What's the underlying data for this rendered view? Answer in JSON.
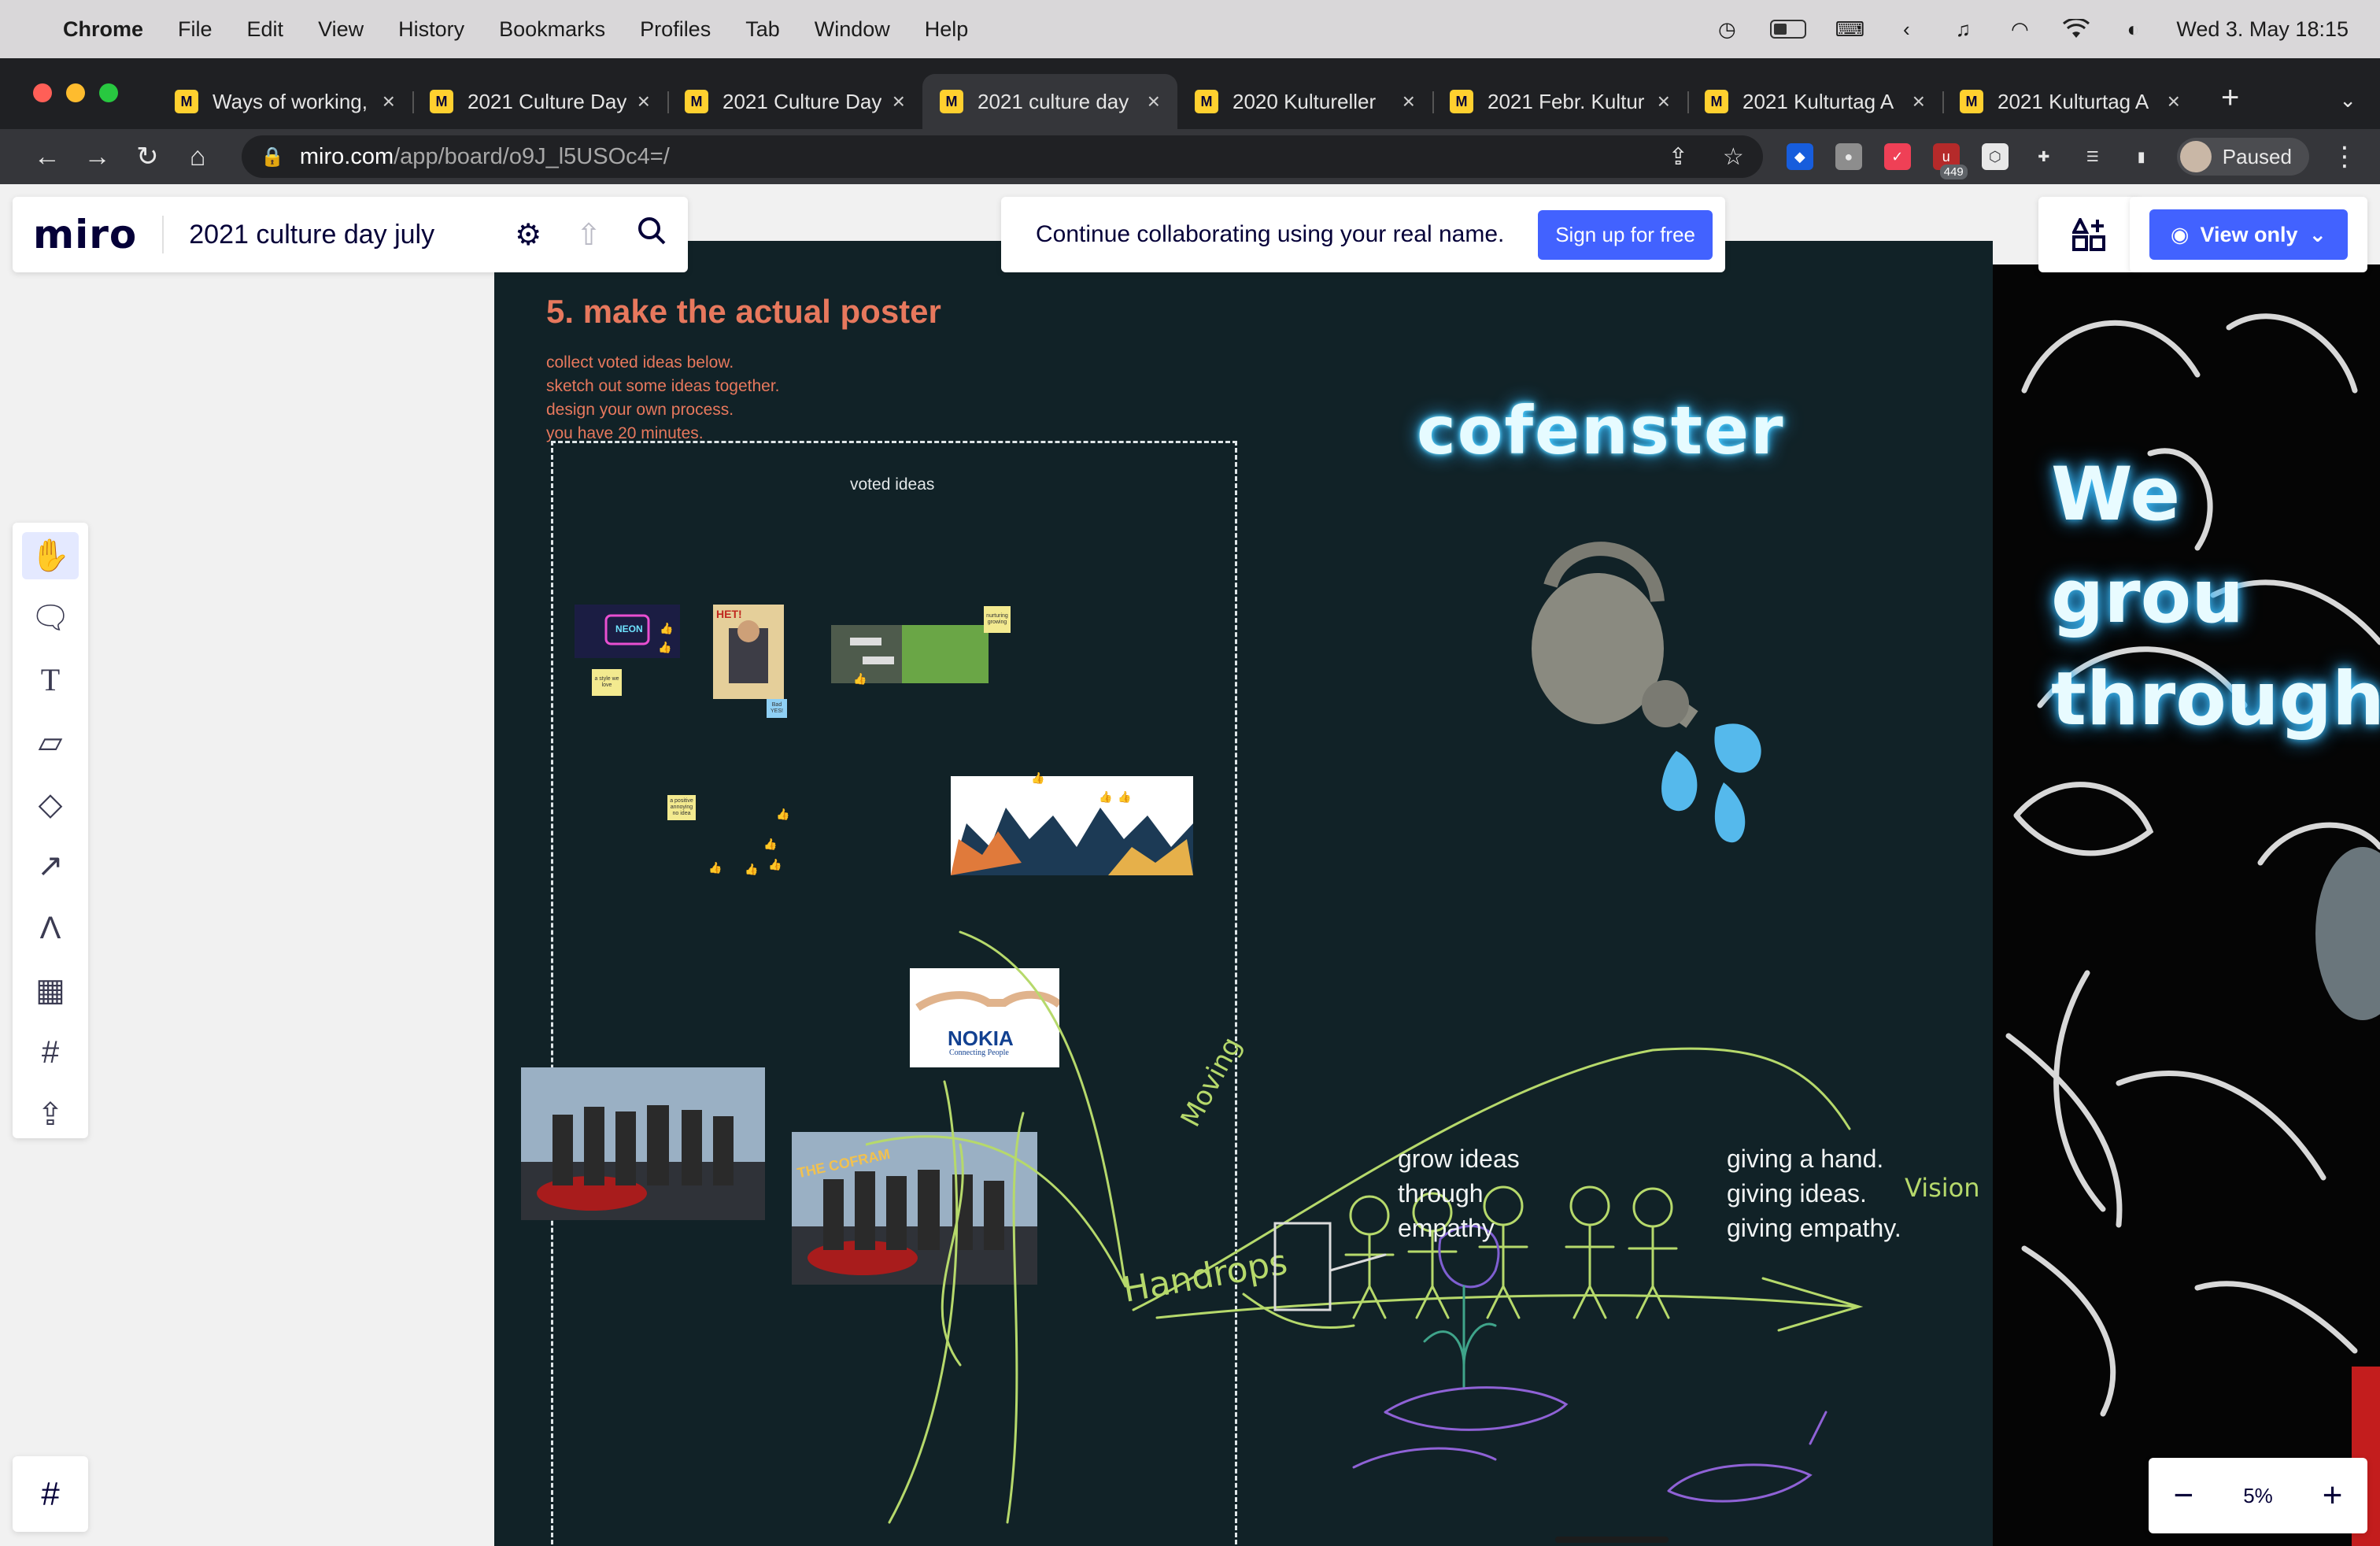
{
  "menubar": {
    "app": "Chrome",
    "items": [
      "File",
      "Edit",
      "View",
      "History",
      "Bookmarks",
      "Profiles",
      "Tab",
      "Window",
      "Help"
    ],
    "clock": "Wed 3. May  18:15"
  },
  "tabs": [
    {
      "title": "Ways of working,",
      "active": false
    },
    {
      "title": "2021 Culture Day",
      "active": false
    },
    {
      "title": "2021 Culture Day",
      "active": false
    },
    {
      "title": "2021 culture day",
      "active": true
    },
    {
      "title": "2020 Kultureller",
      "active": false
    },
    {
      "title": "2021 Febr. Kultur",
      "active": false
    },
    {
      "title": "2021 Kulturtag A",
      "active": false
    },
    {
      "title": "2021 Kulturtag A",
      "active": false
    }
  ],
  "tab_favicon": "M",
  "toolbar": {
    "url_host": "miro.com",
    "url_path": "/app/board/o9J_l5USOc4=/",
    "extension_badge": "449",
    "profile_label": "Paused"
  },
  "miro": {
    "logo": "miro",
    "board_name": "2021 culture day july",
    "banner_text": "Continue collaborating using your real name.",
    "signup_label": "Sign up for free",
    "view_only_label": "View only",
    "zoom_level": "5%",
    "zoom_minus": "−",
    "zoom_plus": "+"
  },
  "board": {
    "section_title": "5. make the actual poster",
    "instructions": [
      "collect voted ideas below.",
      "sketch out some ideas together.",
      "design your own process.",
      "you have 20 minutes."
    ],
    "voted_label": "voted ideas",
    "neon_logo": "cofenster",
    "caption_left": "grow ideas\nthrough\nempathy",
    "caption_right": "giving a hand.\ngiving ideas.\ngiving empathy.",
    "neon_side": "We grou\nthrough",
    "handwriting": [
      "Moving",
      "Handrops",
      "Vision"
    ],
    "image_neon_text": "NEON",
    "image_poster_text": "НЕТ!",
    "image_movie_text": "THE COFRAM",
    "image_logo_text": "NOKIA",
    "image_logo_tagline": "Connecting People",
    "sticky_notes": [
      "a style we love",
      "Bad YES!",
      "nurturing growing",
      "a positive annoying no idea"
    ]
  },
  "colors": {
    "accent": "#4262ff",
    "frame_bg": "#112227",
    "section_title": "#e7785d",
    "sketch_green": "#b6d96b",
    "neon_glow": "#3ec9ff"
  }
}
